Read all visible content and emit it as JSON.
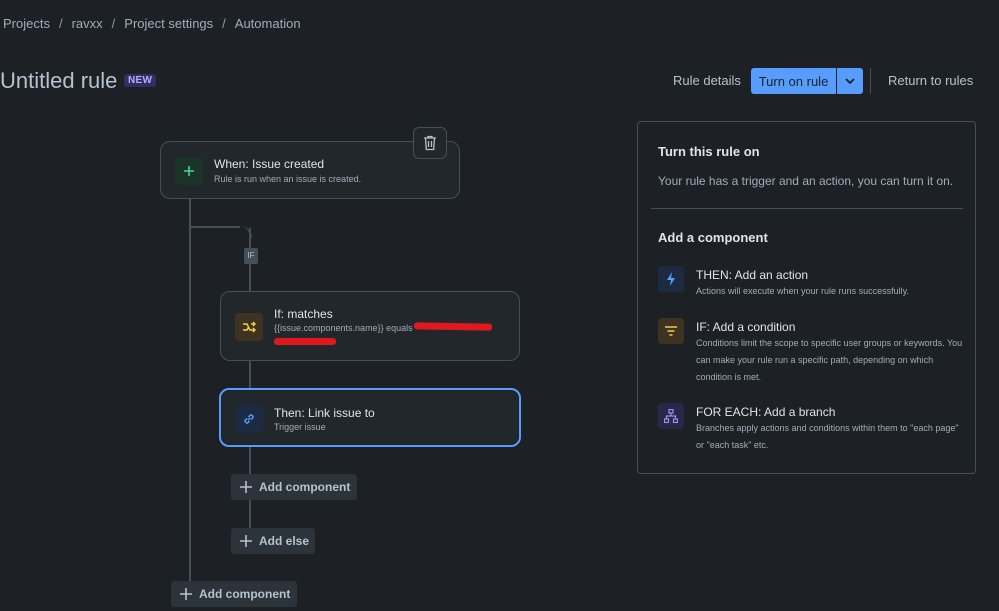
{
  "breadcrumb": [
    "Projects",
    "ravxx",
    "Project settings",
    "Automation"
  ],
  "breadcrumb_separator": "/",
  "title": "Untitled rule",
  "title_badge": "NEW",
  "header": {
    "rule_details": "Rule details",
    "turn_on_rule": "Turn on rule",
    "return_to_rules": "Return to rules"
  },
  "flow": {
    "trigger": {
      "title": "When: Issue created",
      "subtitle": "Rule is run when an issue is created.",
      "icon": "plus-icon"
    },
    "if_badge": "IF",
    "condition": {
      "title": "If: matches",
      "subtitle": "{{issue.components.name}} equals",
      "icon": "branch-icon"
    },
    "action": {
      "title": "Then: Link issue to",
      "subtitle": "Trigger issue",
      "icon": "link-icon"
    },
    "add_component_inner": "Add component",
    "add_else": "Add else",
    "add_component_outer": "Add component"
  },
  "panel": {
    "heading": "Turn this rule on",
    "description": "Your rule has a trigger and an action, you can turn it on.",
    "add_heading": "Add a component",
    "components": [
      {
        "title": "THEN: Add an action",
        "desc": "Actions will execute when your rule runs successfully.",
        "icon": "lightning-icon",
        "color": "#579dff"
      },
      {
        "title": "IF: Add a condition",
        "desc": "Conditions limit the scope to specific user groups or keywords. You can make your rule run a specific path, depending on which condition is met.",
        "icon": "filter-icon",
        "color": "#f5cd47"
      },
      {
        "title": "FOR EACH: Add a branch",
        "desc": "Branches apply actions and conditions within them to \"each page\" or \"each task\" etc.",
        "icon": "hierarchy-icon",
        "color": "#9f8fef"
      }
    ]
  },
  "colors": {
    "accent": "#579dff",
    "background": "#1d2125",
    "card": "#22272b",
    "border": "#454f59"
  }
}
